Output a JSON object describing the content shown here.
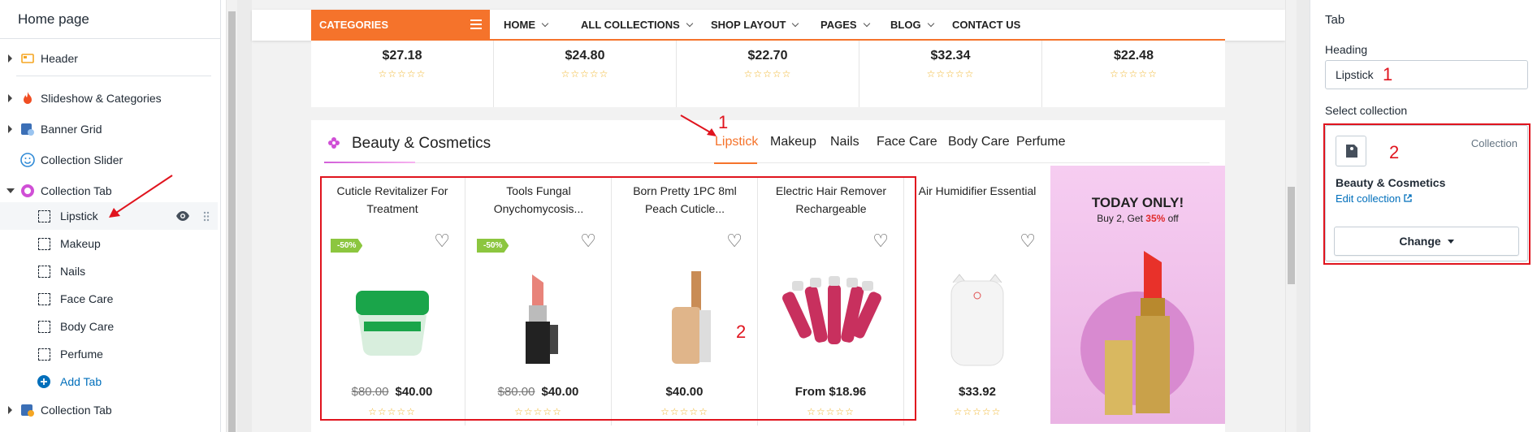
{
  "left_panel": {
    "title": "Home page",
    "sections": [
      {
        "label": "Header"
      },
      {
        "label": "Slideshow & Categories"
      },
      {
        "label": "Banner Grid"
      },
      {
        "label": "Collection Slider"
      },
      {
        "label": "Collection Tab"
      }
    ],
    "tabs": [
      "Lipstick",
      "Makeup",
      "Nails",
      "Face Care",
      "Body Care",
      "Perfume"
    ],
    "add_tab": "Add Tab",
    "last_section": "Collection Tab"
  },
  "store": {
    "categories_label": "CATEGORIES",
    "nav": [
      "HOME",
      "ALL COLLECTIONS",
      "SHOP LAYOUT",
      "PAGES",
      "BLOG",
      "CONTACT US"
    ],
    "top_prices": [
      "$27.18",
      "$24.80",
      "$22.70",
      "$32.34",
      "$22.48"
    ],
    "section_title": "Beauty & Cosmetics",
    "tabs": [
      "Lipstick",
      "Makeup",
      "Nails",
      "Face Care",
      "Body Care",
      "Perfume"
    ],
    "products": [
      {
        "name": "Cuticle Revitalizer For Treatment",
        "old": "$80.00",
        "price": "$40.00",
        "badge": "-50%"
      },
      {
        "name": "Tools Fungal Onychomycosis...",
        "old": "$80.00",
        "price": "$40.00",
        "badge": "-50%"
      },
      {
        "name": "Born Pretty 1PC 8ml Peach Cuticle...",
        "old": "",
        "price": "$40.00",
        "badge": ""
      },
      {
        "name": "Electric Hair Remover Rechargeable",
        "old": "",
        "price": "From $18.96",
        "badge": ""
      },
      {
        "name": "Air Humidifier Essential",
        "old": "",
        "price": "$33.92",
        "badge": ""
      }
    ],
    "stars": "☆☆☆☆☆",
    "banner": {
      "headline": "TODAY ONLY!",
      "sub_prefix": "Buy 2, Get ",
      "sub_highlight": "35%",
      "sub_suffix": " off"
    }
  },
  "annotations": {
    "one": "1",
    "two": "2"
  },
  "right_panel": {
    "title": "Tab",
    "heading_label": "Heading",
    "heading_value": "Lipstick",
    "select_label": "Select collection",
    "collection_type": "Collection",
    "collection_name": "Beauty & Cosmetics",
    "edit_link": "Edit collection",
    "change_button": "Change"
  },
  "colors": {
    "accent": "#f5732b",
    "annotation": "#e0141e",
    "link": "#006fbb"
  }
}
